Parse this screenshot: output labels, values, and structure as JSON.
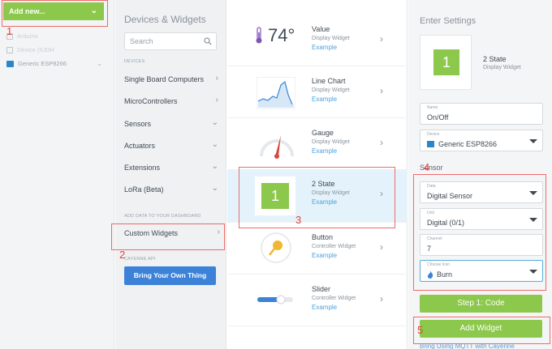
{
  "sidebar": {
    "add_new_label": "Add new...",
    "devices": [
      {
        "label": "Arduino",
        "icon": "plug-icon"
      },
      {
        "label": "Device (IUDH",
        "icon": "device-icon"
      },
      {
        "label": "Generic ESP8266",
        "icon": "board-icon"
      }
    ]
  },
  "devices_panel": {
    "title": "Devices & Widgets",
    "search_placeholder": "Search",
    "devices_section_label": "DEVICES",
    "categories": [
      {
        "label": "Single Board Computers",
        "chevron": "›"
      },
      {
        "label": "MicroControllers",
        "chevron": "›"
      },
      {
        "label": "Sensors",
        "chevron": "⌄"
      },
      {
        "label": "Actuators",
        "chevron": "⌄"
      },
      {
        "label": "Extensions",
        "chevron": "⌄"
      },
      {
        "label": "LoRa (Beta)",
        "chevron": "⌄"
      }
    ],
    "dashboard_section_label": "ADD DATA TO YOUR DASHBOARD",
    "custom_widgets_label": "Custom Widgets",
    "byot_section_label": "CAYENNE API",
    "bring_button_label": "Bring Your Own Thing"
  },
  "widgets": [
    {
      "title": "Value",
      "type": "Display Widget",
      "link": "Example",
      "preview_text": "74°"
    },
    {
      "title": "Line Chart",
      "type": "Display Widget",
      "link": "Example"
    },
    {
      "title": "Gauge",
      "type": "Display Widget",
      "link": "Example"
    },
    {
      "title": "2 State",
      "type": "Display Widget",
      "link": "Example",
      "preview_text": "1"
    },
    {
      "title": "Button",
      "type": "Controller Widget",
      "link": "Example"
    },
    {
      "title": "Slider",
      "type": "Controller Widget",
      "link": "Example"
    }
  ],
  "settings": {
    "title": "Enter Settings",
    "preview_value": "1",
    "preview_title": "2 State",
    "preview_type": "Display Widget",
    "name_label": "Name",
    "name_value": "On/Off",
    "device_label": "Device",
    "device_value": "Generic ESP8266",
    "sensor_label": "Sensor",
    "data_label": "Data",
    "data_value": "Digital Sensor",
    "unit_label": "Unit",
    "unit_value": "Digital (0/1)",
    "channel_label": "Channel",
    "channel_value": "7",
    "icon_label": "Choose Icon",
    "icon_value": "Burn",
    "step_button_label": "Step 1: Code",
    "add_widget_label": "Add Widget",
    "bottom_link": "Bring Using MQTT with Cayenne"
  },
  "annotations": [
    "1",
    "2",
    "3",
    "4",
    "5"
  ],
  "colors": {
    "accent_green": "#8cc84b",
    "accent_blue": "#3c82d9",
    "link_blue": "#4aa3df",
    "annotation_red": "#e2453f"
  }
}
